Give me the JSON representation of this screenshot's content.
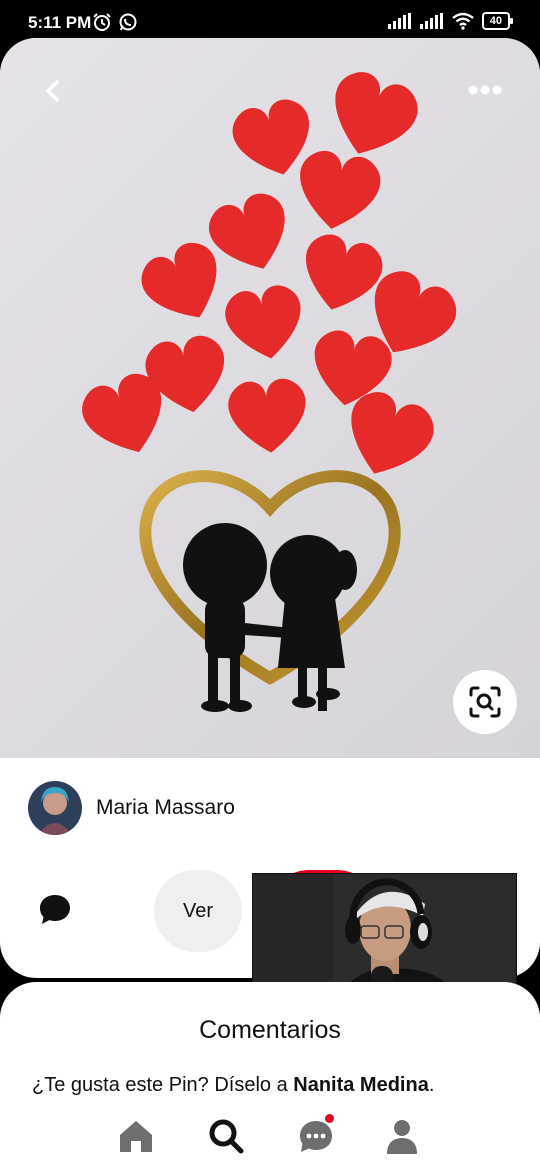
{
  "status_bar": {
    "time": "5:11 PM",
    "battery": "40",
    "icons": [
      "alarm-icon",
      "whatsapp-icon",
      "signal-icon",
      "signal-icon",
      "wifi-icon",
      "battery-icon"
    ]
  },
  "pin": {
    "author_name": "Maria Massaro",
    "ver_label": "Ver"
  },
  "comments": {
    "title": "Comentarios",
    "prompt_prefix": "¿Te gusta este Pin? Díselo a ",
    "prompt_name": "Nanita Medina",
    "prompt_suffix": "."
  },
  "nav": {
    "items": [
      "home-icon",
      "search-icon",
      "messages-icon",
      "profile-icon"
    ],
    "has_notification": true
  },
  "colors": {
    "brand_red": "#e60023",
    "heart_red": "#e52a2a",
    "gold": "#b8922d",
    "button_gray": "#efefef"
  }
}
